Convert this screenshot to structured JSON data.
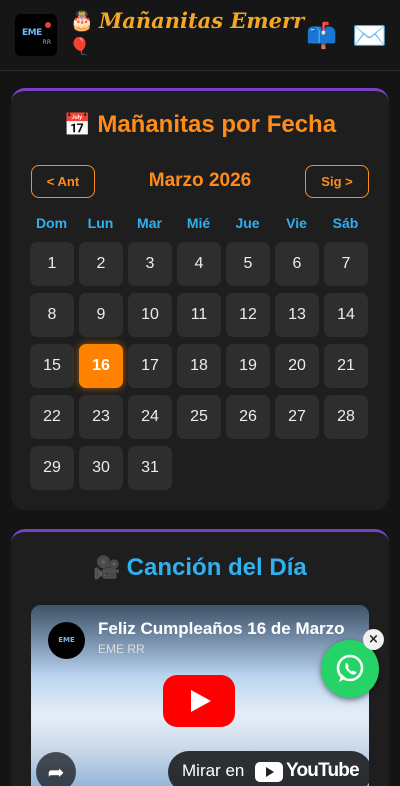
{
  "header": {
    "logo_text": "EME",
    "logo_sub": "RR",
    "cake_icon": "🎂",
    "title": "Mañanitas Emerr",
    "balloon_icon": "🎈",
    "mailbox_icon": "📫",
    "envelope_icon": "✉️"
  },
  "calendar": {
    "icon": "📅",
    "title": "Mañanitas por Fecha",
    "prev_label": "< Ant",
    "next_label": "Sig >",
    "month": "Marzo 2026",
    "weekdays": [
      "Dom",
      "Lun",
      "Mar",
      "Mié",
      "Jue",
      "Vie",
      "Sáb"
    ],
    "days": [
      "1",
      "2",
      "3",
      "4",
      "5",
      "6",
      "7",
      "8",
      "9",
      "10",
      "11",
      "12",
      "13",
      "14",
      "15",
      "16",
      "17",
      "18",
      "19",
      "20",
      "21",
      "22",
      "23",
      "24",
      "25",
      "26",
      "27",
      "28",
      "29",
      "30",
      "31"
    ],
    "selected_day": "16",
    "accent_color": "#ff8c1a",
    "weekday_color": "#2fb1f0"
  },
  "song": {
    "icon": "🎥",
    "title": "Canción del Día",
    "video": {
      "title": "Feliz Cumpleaños 16 de Marzo",
      "channel": "EME RR",
      "avatar_text": "EME",
      "watch_on": "Mirar en",
      "youtube": "YouTube"
    }
  },
  "whatsapp": {
    "close_label": "×",
    "color": "#25d366"
  }
}
